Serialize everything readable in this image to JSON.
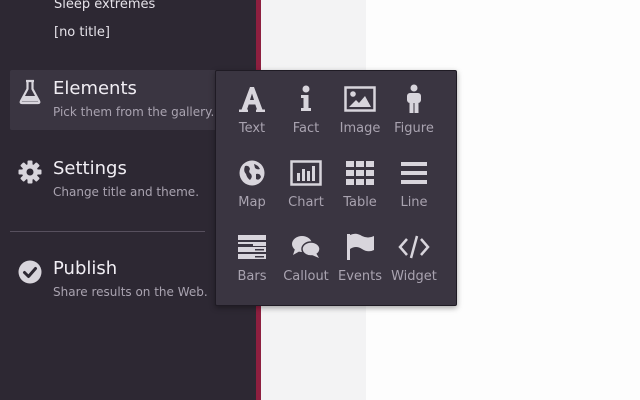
{
  "story_list": [
    "Sleep extremes",
    "[no title]"
  ],
  "nav": [
    {
      "title": "Elements",
      "desc": "Pick them from the gallery.",
      "icon": "flask-icon"
    },
    {
      "title": "Settings",
      "desc": "Change title and theme.",
      "icon": "gear-icon"
    },
    {
      "title": "Publish",
      "desc": "Share results on the Web.",
      "icon": "check-circle-icon"
    }
  ],
  "gallery": [
    {
      "label": "Text",
      "icon": "text-icon"
    },
    {
      "label": "Fact",
      "icon": "info-icon"
    },
    {
      "label": "Image",
      "icon": "image-icon"
    },
    {
      "label": "Figure",
      "icon": "figure-icon"
    },
    {
      "label": "Map",
      "icon": "globe-icon"
    },
    {
      "label": "Chart",
      "icon": "bar-chart-icon"
    },
    {
      "label": "Table",
      "icon": "table-icon"
    },
    {
      "label": "Line",
      "icon": "lines-icon"
    },
    {
      "label": "Bars",
      "icon": "bars-icon"
    },
    {
      "label": "Callout",
      "icon": "speech-bubbles-icon"
    },
    {
      "label": "Events",
      "icon": "flag-icon"
    },
    {
      "label": "Widget",
      "icon": "code-icon"
    }
  ],
  "colors": {
    "sidebar": "#2d2833",
    "accent": "#8d1f3f",
    "panel": "#3a3541",
    "icon": "#d8d5dc"
  }
}
